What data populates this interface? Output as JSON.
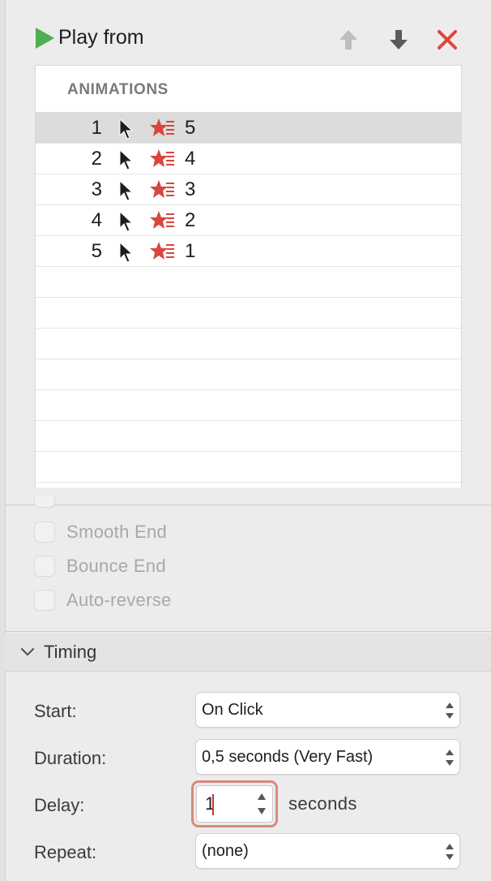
{
  "toolbar": {
    "play_label": "Play from"
  },
  "animations": {
    "header": "ANIMATIONS",
    "rows": [
      {
        "order": "1",
        "target": "5",
        "selected": true
      },
      {
        "order": "2",
        "target": "4",
        "selected": false
      },
      {
        "order": "3",
        "target": "3",
        "selected": false
      },
      {
        "order": "4",
        "target": "2",
        "selected": false
      },
      {
        "order": "5",
        "target": "1",
        "selected": false
      }
    ]
  },
  "effect_options": {
    "smooth_end": {
      "label": "Smooth End",
      "checked": false,
      "enabled": false
    },
    "bounce_end": {
      "label": "Bounce End",
      "checked": false,
      "enabled": false
    },
    "auto_reverse": {
      "label": "Auto-reverse",
      "checked": false,
      "enabled": false
    }
  },
  "timing": {
    "title": "Timing",
    "start_label": "Start:",
    "start_value": "On Click",
    "duration_label": "Duration:",
    "duration_value": "0,5 seconds (Very Fast)",
    "delay_label": "Delay:",
    "delay_value": "1",
    "delay_units": "seconds",
    "repeat_label": "Repeat:",
    "repeat_value": "(none)"
  },
  "colors": {
    "play_green": "#4caf50",
    "delete_red": "#e0443f",
    "star_red": "#d9453f",
    "focus_ring": "#d9897b"
  }
}
